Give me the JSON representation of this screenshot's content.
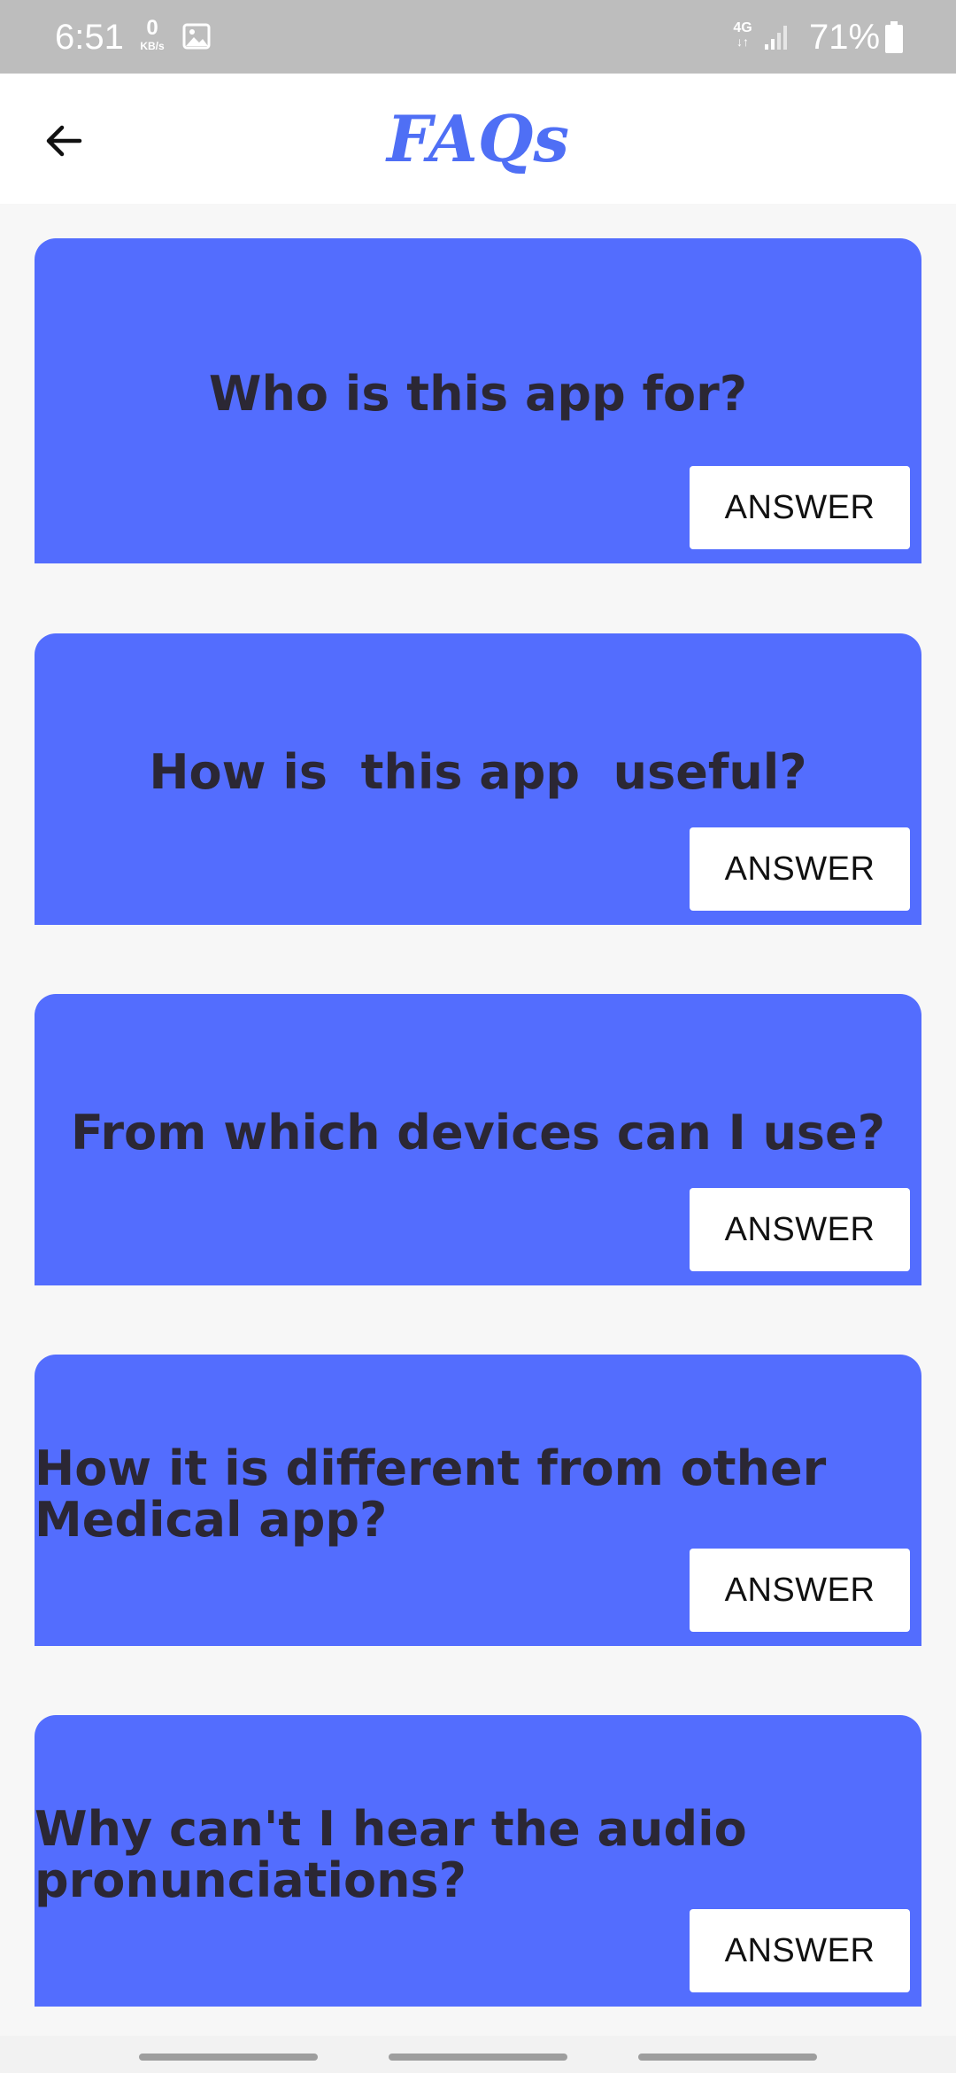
{
  "status_bar": {
    "time": "6:51",
    "data_rate": "0",
    "data_rate_unit": "KB/s",
    "network": "4G",
    "battery": "71%",
    "text_color": "#ffffff",
    "background": "#bdbdbd",
    "icons": [
      "image-icon",
      "signal-icon",
      "battery-icon"
    ]
  },
  "header": {
    "title": "FAQs",
    "title_color": "#4f6ff5",
    "back_icon": "arrow-left-icon"
  },
  "faqs": [
    {
      "question": "Who is this app for?",
      "button": "ANSWER"
    },
    {
      "question": "How is  this app  useful?",
      "button": "ANSWER"
    },
    {
      "question": "From which devices can I use?",
      "button": "ANSWER"
    },
    {
      "question": "How it is different from other\nMedical app?",
      "button": "ANSWER"
    },
    {
      "question": "Why can't I hear the audio\npronunciations?",
      "button": "ANSWER"
    }
  ],
  "colors": {
    "card": "#536dfe",
    "question_text": "#2b2734",
    "button_bg": "#ffffff"
  }
}
